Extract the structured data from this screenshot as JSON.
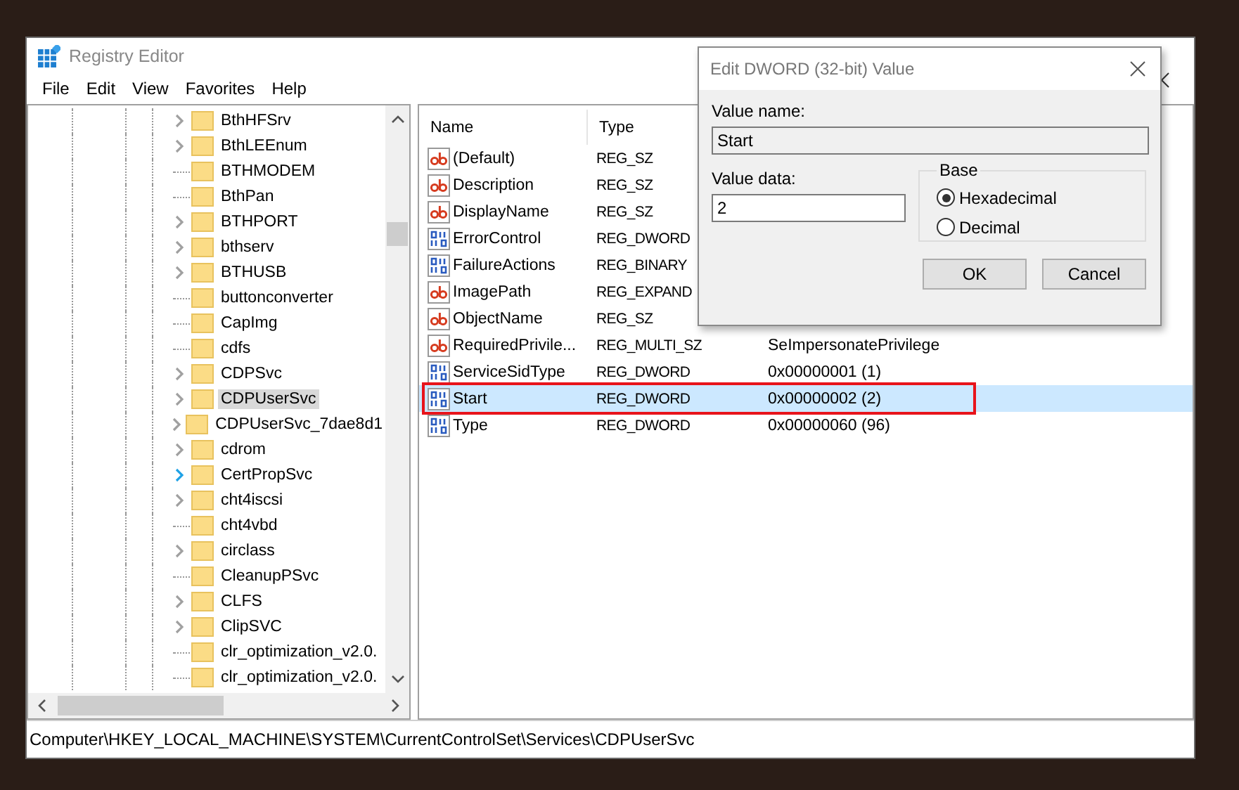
{
  "window": {
    "title": "Registry Editor"
  },
  "menu": [
    "File",
    "Edit",
    "View",
    "Favorites",
    "Help"
  ],
  "tree": {
    "items": [
      {
        "label": "BthHFSrv",
        "has_children": true,
        "selected": false,
        "hovered": false
      },
      {
        "label": "BthLEEnum",
        "has_children": true,
        "selected": false,
        "hovered": false
      },
      {
        "label": "BTHMODEM",
        "has_children": false,
        "selected": false,
        "hovered": false
      },
      {
        "label": "BthPan",
        "has_children": false,
        "selected": false,
        "hovered": false
      },
      {
        "label": "BTHPORT",
        "has_children": true,
        "selected": false,
        "hovered": false
      },
      {
        "label": "bthserv",
        "has_children": true,
        "selected": false,
        "hovered": false
      },
      {
        "label": "BTHUSB",
        "has_children": true,
        "selected": false,
        "hovered": false
      },
      {
        "label": "buttonconverter",
        "has_children": false,
        "selected": false,
        "hovered": false
      },
      {
        "label": "CapImg",
        "has_children": false,
        "selected": false,
        "hovered": false
      },
      {
        "label": "cdfs",
        "has_children": false,
        "selected": false,
        "hovered": false
      },
      {
        "label": "CDPSvc",
        "has_children": true,
        "selected": false,
        "hovered": false
      },
      {
        "label": "CDPUserSvc",
        "has_children": true,
        "selected": true,
        "hovered": false
      },
      {
        "label": "CDPUserSvc_7dae8d1",
        "has_children": true,
        "selected": false,
        "hovered": false
      },
      {
        "label": "cdrom",
        "has_children": true,
        "selected": false,
        "hovered": false
      },
      {
        "label": "CertPropSvc",
        "has_children": true,
        "selected": false,
        "hovered": true
      },
      {
        "label": "cht4iscsi",
        "has_children": true,
        "selected": false,
        "hovered": false
      },
      {
        "label": "cht4vbd",
        "has_children": false,
        "selected": false,
        "hovered": false
      },
      {
        "label": "circlass",
        "has_children": true,
        "selected": false,
        "hovered": false
      },
      {
        "label": "CleanupPSvc",
        "has_children": false,
        "selected": false,
        "hovered": false
      },
      {
        "label": "CLFS",
        "has_children": true,
        "selected": false,
        "hovered": false
      },
      {
        "label": "ClipSVC",
        "has_children": true,
        "selected": false,
        "hovered": false
      },
      {
        "label": "clr_optimization_v2.0.",
        "has_children": false,
        "selected": false,
        "hovered": false
      },
      {
        "label": "clr_optimization_v2.0.",
        "has_children": false,
        "selected": false,
        "hovered": false
      }
    ]
  },
  "values": {
    "columns": [
      "Name",
      "Type"
    ],
    "rows": [
      {
        "kind": "string",
        "name": "(Default)",
        "type": "REG_SZ",
        "selected": false,
        "highlighted": false
      },
      {
        "kind": "string",
        "name": "Description",
        "type": "REG_SZ",
        "selected": false,
        "highlighted": false
      },
      {
        "kind": "string",
        "name": "DisplayName",
        "type": "REG_SZ",
        "selected": false,
        "highlighted": false
      },
      {
        "kind": "binary",
        "name": "ErrorControl",
        "type": "REG_DWORD",
        "selected": false,
        "highlighted": false
      },
      {
        "kind": "binary",
        "name": "FailureActions",
        "type": "REG_BINARY",
        "selected": false,
        "highlighted": false
      },
      {
        "kind": "string",
        "name": "ImagePath",
        "type": "REG_EXPAND",
        "selected": false,
        "highlighted": false
      },
      {
        "kind": "string",
        "name": "ObjectName",
        "type": "REG_SZ",
        "selected": false,
        "highlighted": false
      },
      {
        "kind": "string",
        "name": "RequiredPrivile...",
        "type": "REG_MULTI_SZ",
        "data": "SeImpersonatePrivilege",
        "selected": false,
        "highlighted": false
      },
      {
        "kind": "binary",
        "name": "ServiceSidType",
        "type": "REG_DWORD",
        "data": "0x00000001 (1)",
        "selected": false,
        "highlighted": false
      },
      {
        "kind": "binary",
        "name": "Start",
        "type": "REG_DWORD",
        "data": "0x00000002 (2)",
        "selected": true,
        "highlighted": true
      },
      {
        "kind": "binary",
        "name": "Type",
        "type": "REG_DWORD",
        "data": "0x00000060 (96)",
        "selected": false,
        "highlighted": false
      }
    ]
  },
  "status_bar": "Computer\\HKEY_LOCAL_MACHINE\\SYSTEM\\CurrentControlSet\\Services\\CDPUserSvc",
  "dialog": {
    "title": "Edit DWORD (32-bit) Value",
    "value_name_label": "Value name:",
    "value_name": "Start",
    "value_data_label": "Value data:",
    "value_data": "2",
    "base_label": "Base",
    "base_options": [
      {
        "label": "Hexadecimal",
        "selected": true
      },
      {
        "label": "Decimal",
        "selected": false
      }
    ],
    "buttons": [
      "OK",
      "Cancel"
    ]
  }
}
